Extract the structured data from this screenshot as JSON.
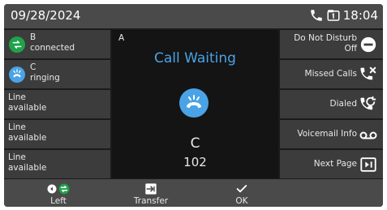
{
  "status_bar": {
    "date": "09/28/2024",
    "time": "18:04",
    "icons": [
      "phone-icon",
      "handset-mode-icon"
    ]
  },
  "line_keys": [
    {
      "name": "B",
      "status": "connected",
      "icon": "call-connected-icon",
      "color": "#1fa34a"
    },
    {
      "name": "C",
      "status": "ringing",
      "icon": "call-ringing-icon",
      "color": "#4aa3e6"
    },
    {
      "name": "Line",
      "status": "available"
    },
    {
      "name": "Line",
      "status": "available"
    },
    {
      "name": "Line",
      "status": "available"
    }
  ],
  "right_keys": [
    {
      "label_line1": "Do Not Disturb",
      "label_line2": "Off",
      "icon": "do-not-disturb-icon"
    },
    {
      "label": "Missed Calls",
      "icon": "missed-calls-icon"
    },
    {
      "label": "Dialed",
      "icon": "dialed-calls-icon"
    },
    {
      "label": "Voicemail Info",
      "icon": "voicemail-icon"
    },
    {
      "label": "Next Page",
      "icon": "next-page-icon"
    }
  ],
  "call_panel": {
    "line_label": "A",
    "status": "Call Waiting",
    "caller_name": "C",
    "caller_number": "102",
    "accent": "#4aa3e6"
  },
  "softkeys": [
    {
      "label": "Left",
      "icon": "left-line-icon"
    },
    {
      "label": "Transfer",
      "icon": "transfer-icon"
    },
    {
      "label": "OK",
      "icon": "check-icon"
    }
  ]
}
